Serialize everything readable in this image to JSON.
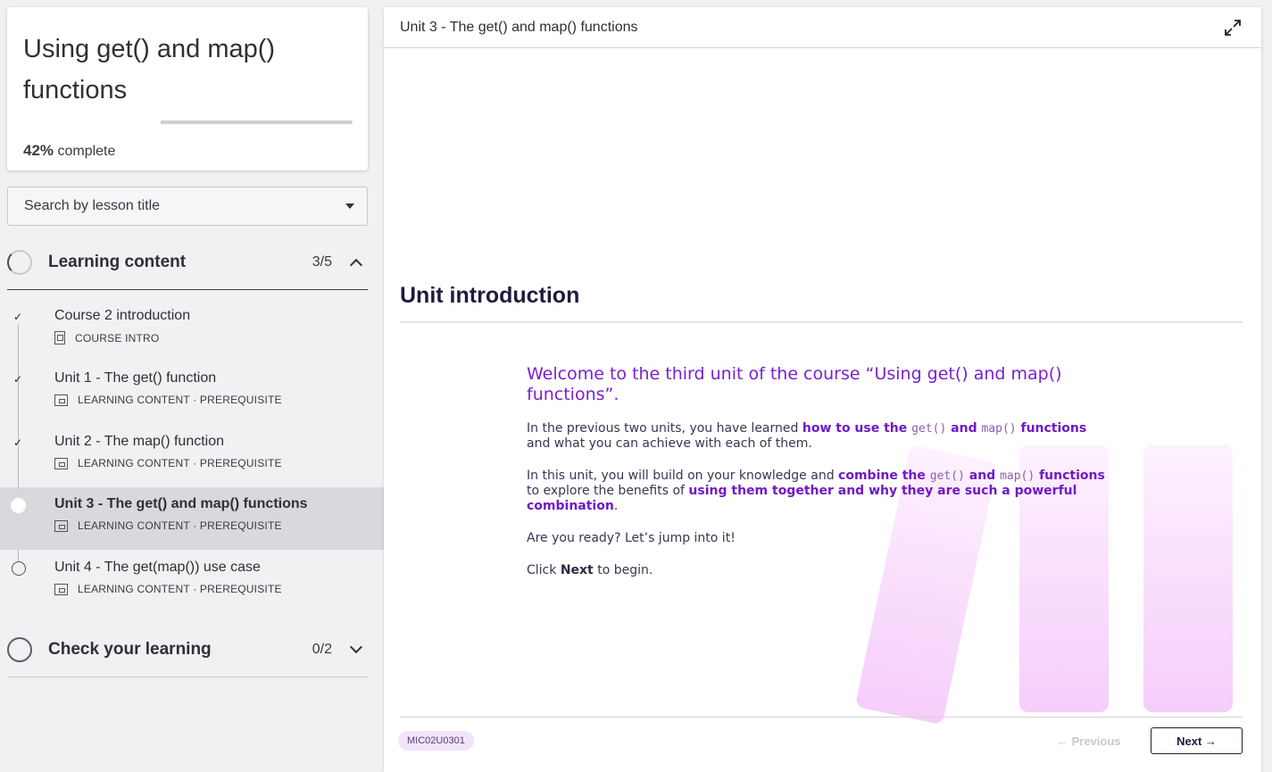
{
  "course": {
    "title": "Using get() and map() functions",
    "progress_percent": 42,
    "progress_value": "42%",
    "progress_suffix": " complete"
  },
  "search": {
    "placeholder": "Search by lesson title"
  },
  "sections": [
    {
      "label": "Learning content",
      "count": "3/5",
      "expanded": true,
      "lessons": [
        {
          "title": "Course 2 introduction",
          "meta": "COURSE INTRO",
          "status": "completed"
        },
        {
          "title": "Unit 1 - The get() function",
          "meta": "LEARNING CONTENT · PREREQUISITE",
          "status": "completed"
        },
        {
          "title": "Unit 2 - The map() function",
          "meta": "LEARNING CONTENT · PREREQUISITE",
          "status": "completed"
        },
        {
          "title": "Unit 3 - The get() and map() functions",
          "meta": "LEARNING CONTENT · PREREQUISITE",
          "status": "current"
        },
        {
          "title": "Unit 4 - The get(map()) use case",
          "meta": "LEARNING CONTENT · PREREQUISITE",
          "status": "not-started"
        }
      ]
    },
    {
      "label": "Check your learning",
      "count": "0/2",
      "expanded": false
    }
  ],
  "main": {
    "header_title": "Unit 3 - The get() and map() functions",
    "heading": "Unit introduction",
    "welcome": "Welcome to the third unit of the course “Using get() and map() functions”.",
    "p1": {
      "lead": "In the previous two units, you have learned ",
      "hl1": "how to use the ",
      "code1": "get()",
      "hl2": " and ",
      "code2": "map()",
      "hl3": " functions",
      "tail": " and what you can achieve with each of them."
    },
    "p2": {
      "lead": "In this unit, you will build on your knowledge and ",
      "hl1": "combine the ",
      "code1": "get()",
      "hl2": " and ",
      "code2": "map()",
      "hl3": " functions",
      "mid": " to explore the benefits of ",
      "hl4": "using them together and why they are such a powerful combination",
      "tail": "."
    },
    "p3": "Are you ready? Let’s jump into it!",
    "p4": {
      "lead": "Click ",
      "strong": "Next",
      "tail": " to begin."
    },
    "badge": "MIC02U0301",
    "prev_label": "← Previous",
    "next_label": "Next →"
  },
  "colors": {
    "accent_purple": "#7a1fd6",
    "heading_navy": "#201a3d",
    "badge_bg": "#f2e4fb"
  }
}
